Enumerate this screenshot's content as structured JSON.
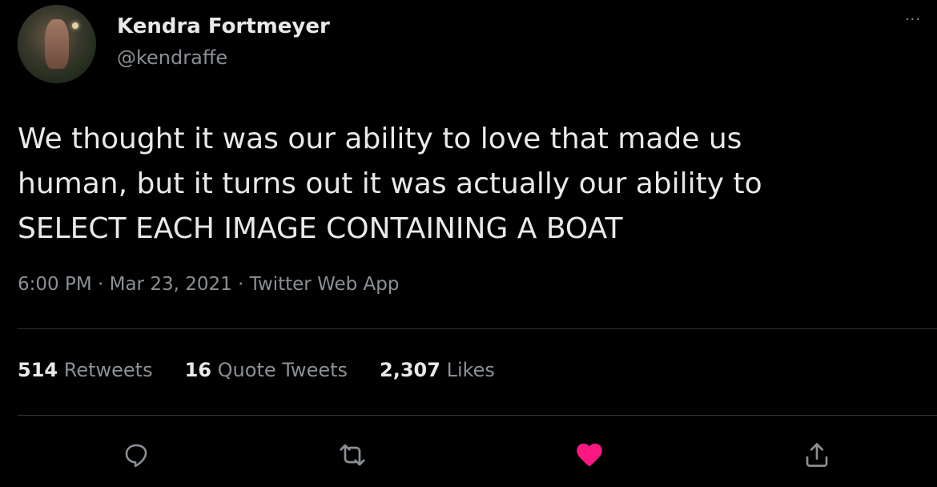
{
  "user": {
    "display_name": "Kendra Fortmeyer",
    "handle": "@kendraffe"
  },
  "tweet": {
    "lines": [
      "We thought it was our ability to love that made us",
      "human, but it turns out it was actually our ability to",
      "SELECT EACH IMAGE CONTAINING A BOAT"
    ],
    "meta": "6:00 PM · Mar 23, 2021 · Twitter Web App"
  },
  "stats": {
    "retweets_count": "514",
    "retweets_label": "Retweets",
    "quotes_count": "16",
    "quotes_label": "Quote Tweets",
    "likes_count": "2,307",
    "likes_label": "Likes"
  },
  "more_glyph": "···",
  "actions": {
    "reply_icon": "reply-icon",
    "retweet_icon": "retweet-icon",
    "like_icon": "heart-icon",
    "share_icon": "share-icon"
  },
  "colors": {
    "background": "#000000",
    "text": "#e7e9ea",
    "secondary": "#8b9096",
    "like": "#f91880",
    "divider": "#2f3336"
  }
}
